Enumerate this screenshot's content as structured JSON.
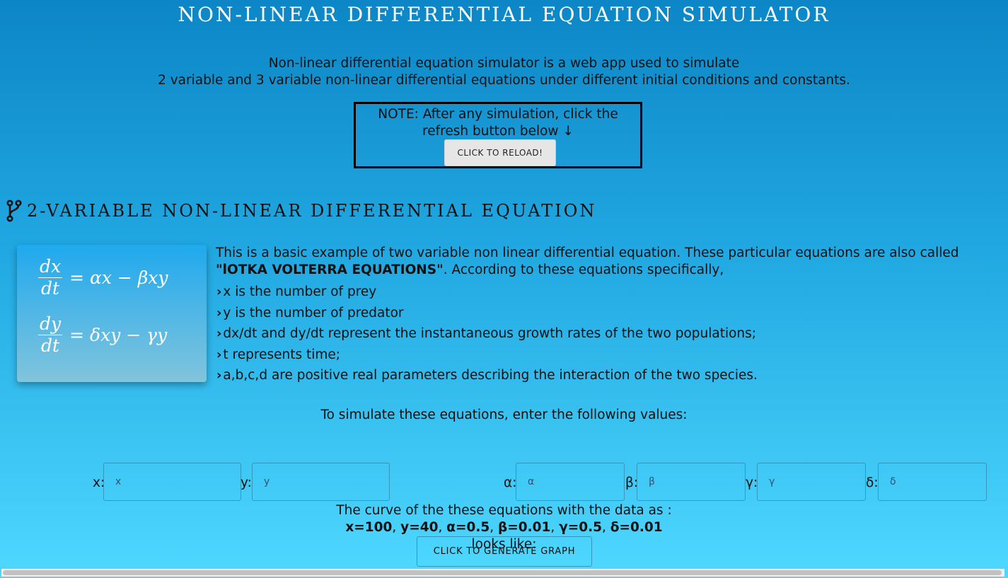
{
  "header": {
    "title": "NON-LINEAR DIFFERENTIAL EQUATION SIMULATOR"
  },
  "intro": {
    "line1": "Non-linear differential equation simulator is a web app used to simulate",
    "line2": "2 variable and 3 variable non-linear differential equations under different initial conditions and constants."
  },
  "note": {
    "line1": "NOTE: After any simulation, click the",
    "line2": "refresh button below ↓",
    "reload_label": "CLICK TO RELOAD!"
  },
  "section": {
    "icon": "branch-icon",
    "title": "2-VARIABLE NON-LINEAR DIFFERENTIAL EQUATION"
  },
  "equations": [
    {
      "num": "dx",
      "den": "dt",
      "rhs": "= αx − βxy"
    },
    {
      "num": "dy",
      "den": "dt",
      "rhs": "= δxy − γy"
    }
  ],
  "description": {
    "intro_a": "This is a basic example of two variable non linear differential equation. These particular equations are also called",
    "intro_bold": "\"lOTKA VOLTERRA EQUATIONS\"",
    "intro_b": ". According to these equations specifically,",
    "bullets": [
      "x is the number of prey",
      "y is the number of predator",
      "dx/dt and dy/dt represent the instantaneous growth rates of the two populations;",
      "t represents time;",
      "a,b,c,d are positive real parameters describing the interaction of the two species."
    ]
  },
  "simulate": {
    "prompt": "To simulate these equations, enter the following values:"
  },
  "fields": [
    {
      "label": "x:",
      "placeholder": "x"
    },
    {
      "label": "y:",
      "placeholder": "y"
    },
    {
      "label": "α:",
      "placeholder": "α"
    },
    {
      "label": "β:",
      "placeholder": "β"
    },
    {
      "label": "γ:",
      "placeholder": "γ"
    },
    {
      "label": "δ:",
      "placeholder": "δ"
    }
  ],
  "curve": {
    "line1": "The curve of the these equations with the data as :",
    "values": [
      "x=100",
      "y=40",
      "α=0.5",
      "β=0.01",
      "γ=0.5",
      "δ=0.01"
    ],
    "suffix": "looks like:",
    "button_label": "CLICK TO GENERATE GRAPH"
  }
}
